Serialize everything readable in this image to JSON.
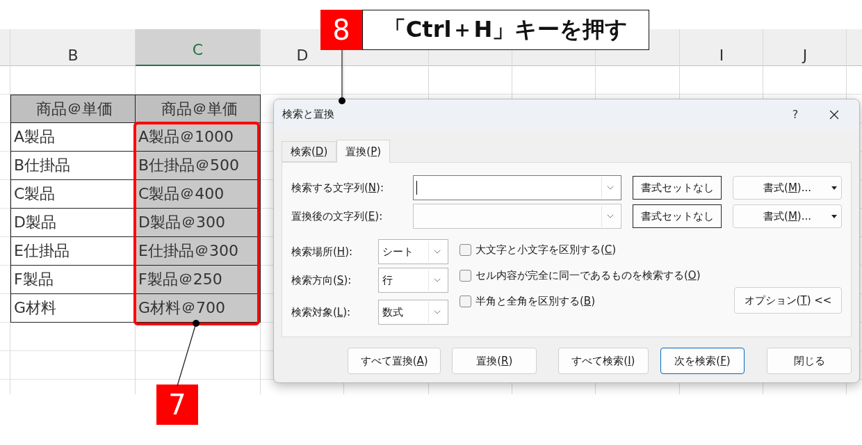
{
  "columns": [
    {
      "label": "B",
      "selected": false
    },
    {
      "label": "C",
      "selected": true
    },
    {
      "label": "D",
      "selected": false
    },
    {
      "label": "I",
      "selected": false
    },
    {
      "label": "J",
      "selected": false
    }
  ],
  "table": {
    "columns": [
      {
        "header": "商品＠単価",
        "shaded": false
      },
      {
        "header": "商品＠単価",
        "shaded": true
      }
    ],
    "rows": [
      [
        "A製品",
        "A製品＠1000"
      ],
      [
        "B仕掛品",
        "B仕掛品＠500"
      ],
      [
        "C製品",
        "C製品＠400"
      ],
      [
        "D製品",
        "D製品＠300"
      ],
      [
        "E仕掛品",
        "E仕掛品＠300"
      ],
      [
        "F製品",
        "F製品＠250"
      ],
      [
        "G材料",
        "G材料＠700"
      ]
    ]
  },
  "dialog": {
    "title": "検索と置換",
    "help": "?",
    "tabs": [
      {
        "label": "検索(",
        "key": "D",
        "end": ")",
        "selected": false
      },
      {
        "label": "置換(",
        "key": "P",
        "end": ")",
        "selected": true
      }
    ],
    "fields": [
      {
        "label": "検索する文字列(",
        "key": "N",
        "end": "):",
        "focused": true,
        "clear_button": "書式セットなし",
        "format_button": {
          "label": "書式(",
          "key": "M",
          "end": ")..."
        }
      },
      {
        "label": "置換後の文字列(",
        "key": "E",
        "end": "):",
        "focused": false,
        "clear_button": "書式セットなし",
        "format_button": {
          "label": "書式(",
          "key": "M",
          "end": ")..."
        }
      }
    ],
    "selects": [
      {
        "label": "検索場所(",
        "key": "H",
        "end": "):",
        "value": "シート"
      },
      {
        "label": "検索方向(",
        "key": "S",
        "end": "):",
        "value": "行"
      },
      {
        "label": "検索対象(",
        "key": "L",
        "end": "):",
        "value": "数式"
      }
    ],
    "checkboxes": [
      {
        "label": "大文字と小文字を区別する(",
        "key": "C",
        "end": ")",
        "checked": false
      },
      {
        "label": "セル内容が完全に同一であるものを検索する(",
        "key": "O",
        "end": ")",
        "checked": false
      },
      {
        "label": "半角と全角を区別する(",
        "key": "B",
        "end": ")",
        "checked": false
      }
    ],
    "options_button": {
      "label": "オプション(",
      "key": "T",
      "end": ") <<"
    },
    "buttons": [
      {
        "label": "すべて置換(",
        "key": "A",
        "end": ")",
        "default": false
      },
      {
        "label": "置換(",
        "key": "R",
        "end": ")",
        "default": false
      },
      {
        "label": "すべて検索(",
        "key": "I",
        "end": ")",
        "default": false
      },
      {
        "label": "次を検索(",
        "key": "F",
        "end": ")",
        "default": true
      },
      {
        "label": "閉じる",
        "default": false
      }
    ]
  },
  "callouts": [
    {
      "number": "8",
      "text": "「Ctrl＋H」キーを押す"
    },
    {
      "number": "7"
    }
  ]
}
